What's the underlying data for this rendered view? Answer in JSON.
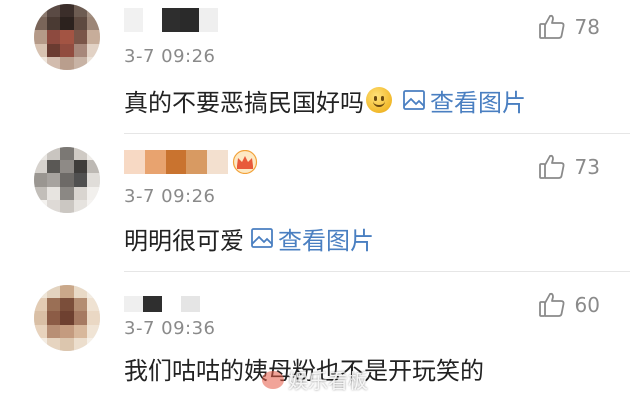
{
  "comments": [
    {
      "time": "3-7 09:26",
      "likes": "78",
      "text": "真的不要恶搞民国好吗",
      "has_emoji": true,
      "pic_link": "查看图片",
      "avatar_colors": [
        "#8c7a6f",
        "#5a4a44",
        "#3b2e2a",
        "#6d5c52",
        "#a18e80",
        "#7a6559",
        "#4a3a33",
        "#2c221e",
        "#5e4a40",
        "#9c8677",
        "#b59a88",
        "#8d4a3f",
        "#a35443",
        "#7a5548",
        "#c7ad9a",
        "#d8c3b2",
        "#6a3b31",
        "#914c3f",
        "#a7877a",
        "#e2d2c5",
        "#f0e6dc",
        "#d2bcae",
        "#b99e8d",
        "#c8b3a5",
        "#ece2d8"
      ]
    },
    {
      "time": "3-7 09:26",
      "likes": "73",
      "text": "明明很可爱",
      "has_emoji": false,
      "pic_link": "查看图片",
      "avatar_colors": [
        "#e9e6e2",
        "#c9c5c0",
        "#7b7874",
        "#cfcac4",
        "#efece8",
        "#d6d2cd",
        "#5a5855",
        "#8e8a86",
        "#3f3d3b",
        "#bdb9b4",
        "#9a9691",
        "#a7a39f",
        "#6d6a67",
        "#505050",
        "#e0ddd9",
        "#c2beb9",
        "#e7e4e0",
        "#8b8884",
        "#d9d5d0",
        "#f2f0ed",
        "#f4f2ef",
        "#dedad6",
        "#cbc7c2",
        "#e6e3df",
        "#f5f3f1"
      ]
    },
    {
      "time": "3-7 09:36",
      "likes": "60",
      "text": "我们咕咕的姨母粉也不是开玩笑的",
      "has_emoji": false,
      "pic_link": "",
      "avatar_colors": [
        "#efe6d8",
        "#e3d3bf",
        "#caa88a",
        "#e9dac7",
        "#f3ece2",
        "#e2cbb3",
        "#9a6f55",
        "#7b4e3a",
        "#b38d72",
        "#efe2d2",
        "#d9bfa5",
        "#8c5c46",
        "#6e4030",
        "#a67a62",
        "#ead8c4",
        "#e8d3bd",
        "#b88f75",
        "#c49b7f",
        "#d8b89c",
        "#f0e4d5",
        "#f4ece2",
        "#e6d4c0",
        "#dcc6ae",
        "#ecdecd",
        "#f6f0e8"
      ]
    }
  ],
  "name_blurs": [
    [
      "#f1f1f1",
      "#ffffff",
      "#2e2e2e",
      "#2a2a2a",
      "#efefef"
    ],
    [
      "#f7d9c4",
      "#e8a36f",
      "#c9732f",
      "#d89a62",
      "#f3e0cf"
    ],
    [
      "#efefef",
      "#2f2f2f",
      "#ffffff",
      "#e5e5e5"
    ]
  ],
  "crown_color": "#e85a3a",
  "link_color": "#4a7fc1",
  "watermark": "娱乐看板",
  "icons": {
    "like": "thumbs-up-icon",
    "picture": "image-icon",
    "emoji": "smile-emoji-icon",
    "vip": "crown-icon",
    "watermark_logo": "weibo-logo-icon"
  }
}
